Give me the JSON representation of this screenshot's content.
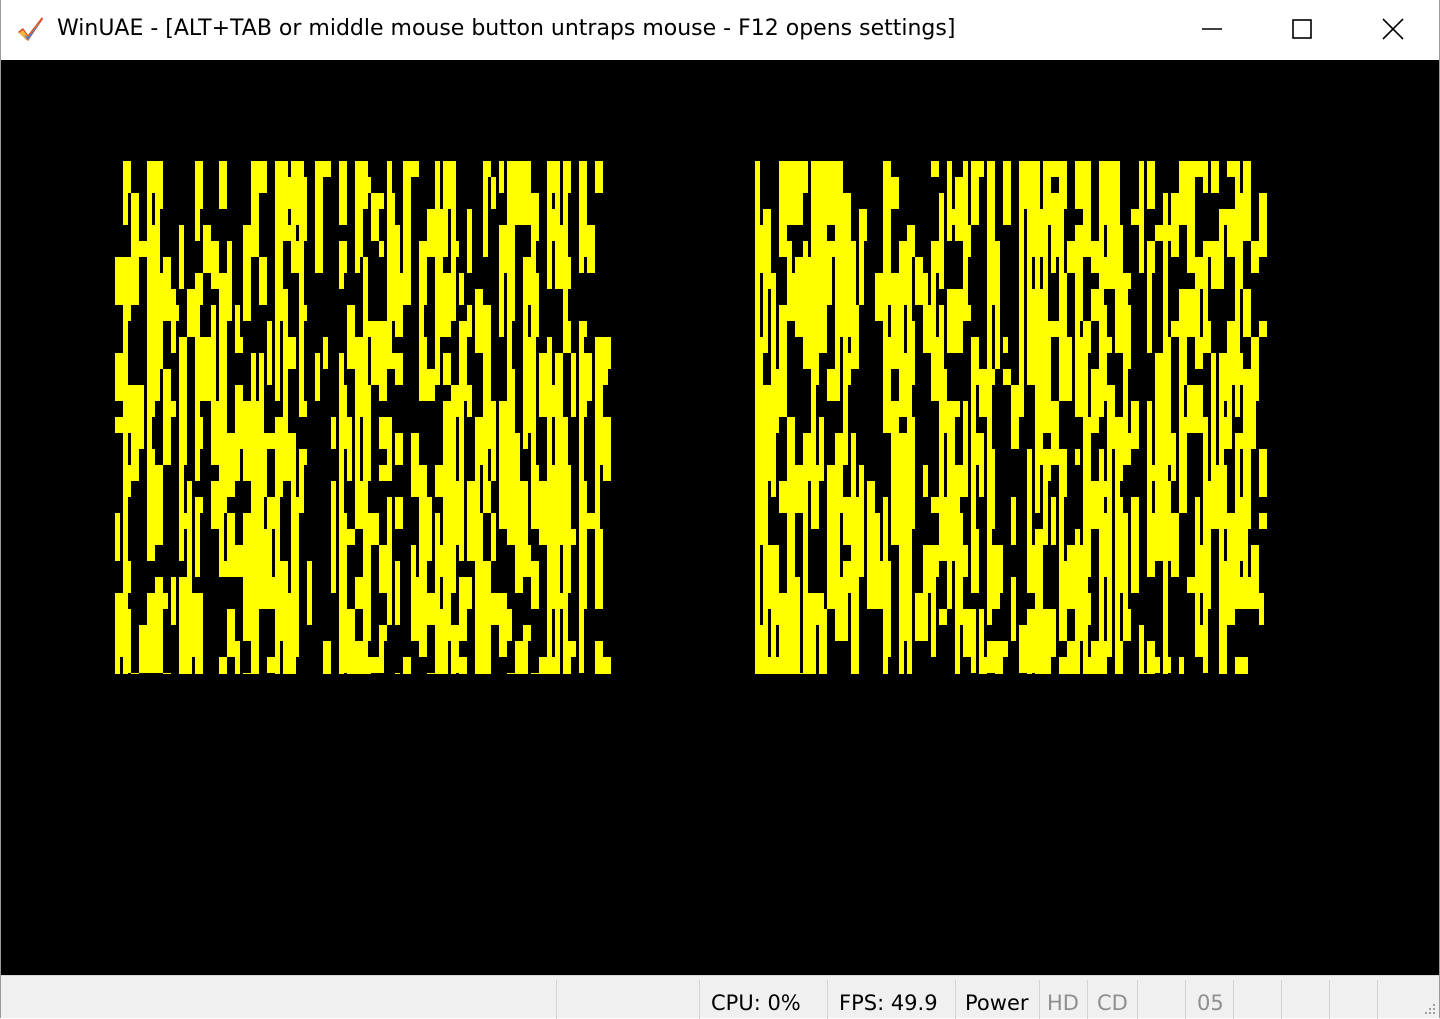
{
  "window": {
    "title": "WinUAE - [ALT+TAB or middle mouse button untraps mouse - F12 opens settings]",
    "app_icon": "checkmark-icon",
    "controls": {
      "minimize_icon": "minimize-icon",
      "maximize_icon": "maximize-icon",
      "close_icon": "close-icon"
    }
  },
  "display": {
    "background_color": "#000000",
    "pattern_color": "#ffff00",
    "panels": [
      "left-pattern-block",
      "right-pattern-block"
    ]
  },
  "statusbar": {
    "cpu": "CPU: 0%",
    "fps": "FPS: 49.9",
    "power": "Power",
    "hd": "HD",
    "cd": "CD",
    "drive_counter": "05"
  }
}
